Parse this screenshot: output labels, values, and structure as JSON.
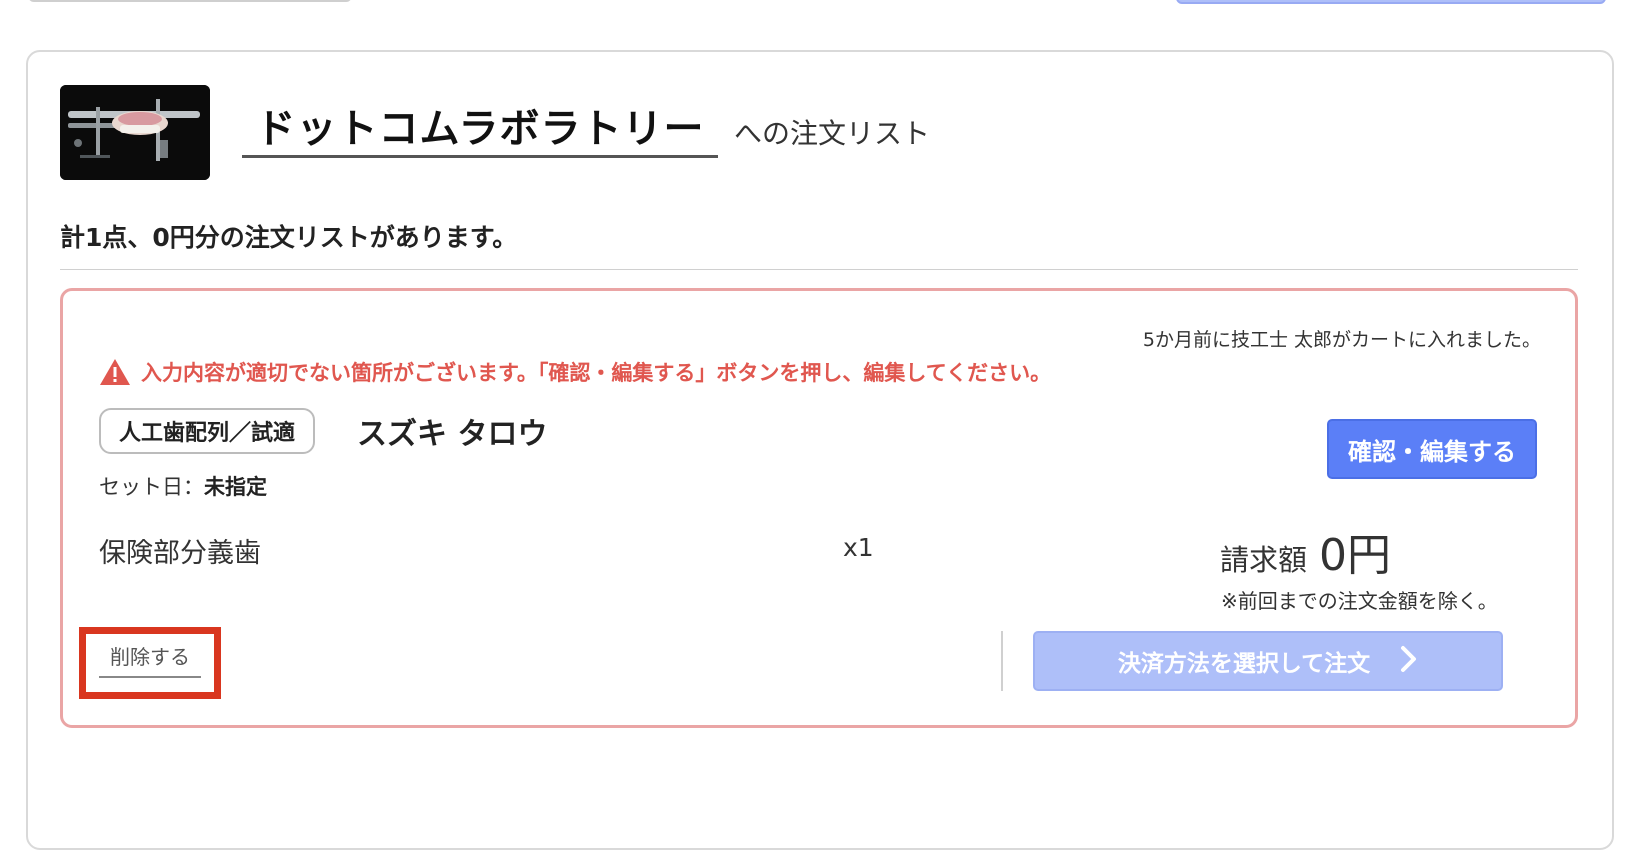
{
  "lab": {
    "name": "ドットコムラボラトリー",
    "title_suffix": "への注文リスト"
  },
  "summary": "計1点、0円分の注文リストがあります。",
  "order": {
    "cart_note": "5か月前に技工士 太郎がカートに入れました。",
    "warning": "入力内容が適切でない箇所がございます。「確認・編集する」ボタンを押し、編集してください。",
    "type_badge": "人工歯配列／試適",
    "patient_name": "スズキ タロウ",
    "set_date_label": "セット日：",
    "set_date_value": "未指定",
    "edit_button": "確認・編集する",
    "product_name": "保険部分義歯",
    "quantity": "x1",
    "billing_label": "請求額",
    "billing_value": "0円",
    "billing_note": "※前回までの注文金額を除く。",
    "delete_link": "削除する",
    "checkout_button": "決済方法を選択して注文"
  },
  "colors": {
    "primary": "#5b7ff7",
    "primary_disabled": "#aebff9",
    "warning": "#e0574f",
    "card_border_error": "#eaa5a5",
    "highlight": "#d9361f"
  },
  "icons": {
    "warning": "warning-triangle-icon",
    "chevron": "chevron-right-icon"
  }
}
